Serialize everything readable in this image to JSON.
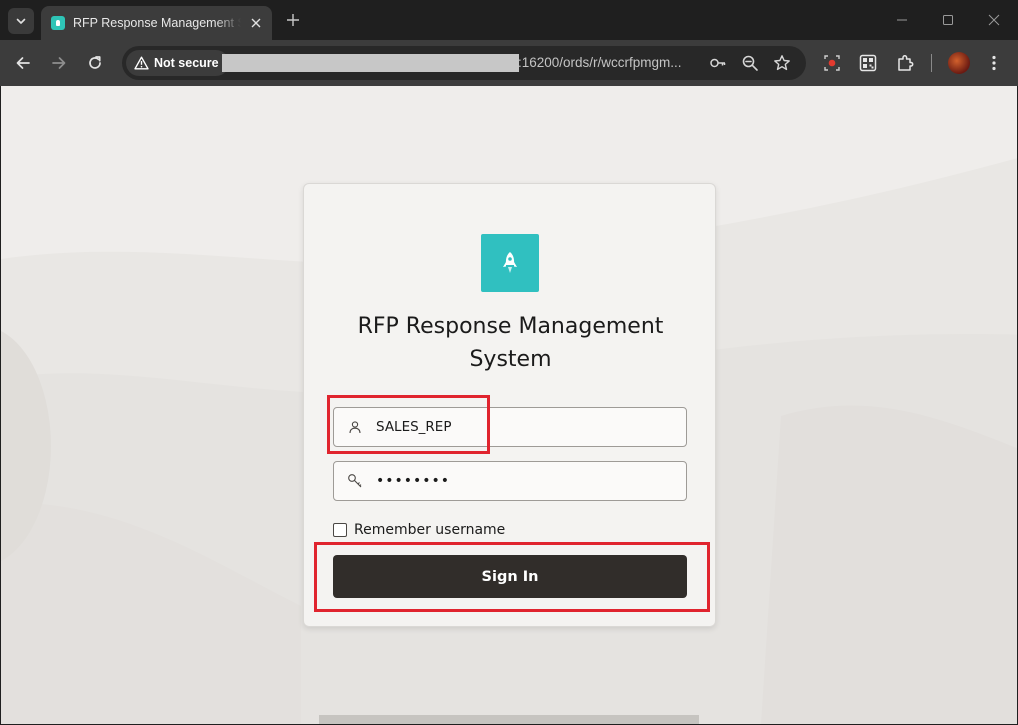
{
  "browser": {
    "tab": {
      "title": "RFP Response Management System",
      "favicon": "rocket-favicon"
    },
    "security_label": "Not secure",
    "url_visible": ":16200/ords/r/wccrfpmgm...",
    "icons": {
      "tab_menu": "chevron-down-icon",
      "tab_close": "close-icon",
      "new_tab": "plus-icon",
      "minimize": "minimize-icon",
      "maximize": "maximize-icon",
      "close_window": "close-icon",
      "back": "arrow-left-icon",
      "forward": "arrow-right-icon",
      "reload": "reload-icon",
      "warning": "warning-icon",
      "key": "key-icon",
      "zoom": "zoom-icon",
      "bookmark": "star-icon",
      "record": "record-icon",
      "qr": "qr-code-icon",
      "extensions": "puzzle-icon",
      "menu": "kebab-menu-icon"
    }
  },
  "login": {
    "logo_icon": "rocket-icon",
    "title": "RFP Response Management System",
    "username": {
      "value": "SALES_REP",
      "icon": "user-icon"
    },
    "password": {
      "value": "••••••••",
      "icon": "key-icon"
    },
    "remember_label": "Remember username",
    "remember_checked": false,
    "sign_in_label": "Sign In"
  },
  "colors": {
    "accent_logo": "#30c0c0",
    "button": "#312d2a",
    "highlight": "#e0242e"
  }
}
